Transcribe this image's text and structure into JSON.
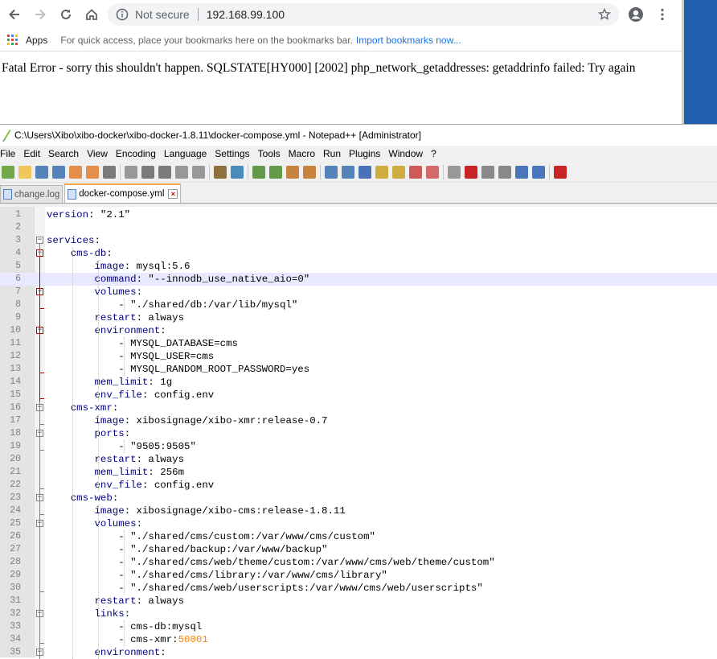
{
  "browser": {
    "security_label": "Not secure",
    "url": "192.168.99.100",
    "bookmarks_apps": "Apps",
    "bookmarks_hint": "For quick access, place your bookmarks here on the bookmarks bar.",
    "bookmarks_import": "Import bookmarks now...",
    "page_error": "Fatal Error - sorry this shouldn't happen. SQLSTATE[HY000] [2002] php_network_getaddresses: getaddrinfo failed: Try again"
  },
  "npp": {
    "title": "C:\\Users\\Xibo\\xibo-docker\\xibo-docker-1.8.11\\docker-compose.yml - Notepad++ [Administrator]",
    "menu": [
      "File",
      "Edit",
      "Search",
      "View",
      "Encoding",
      "Language",
      "Settings",
      "Tools",
      "Macro",
      "Run",
      "Plugins",
      "Window",
      "?"
    ],
    "tabs": [
      {
        "label": "change.log",
        "active": false
      },
      {
        "label": "docker-compose.yml",
        "active": true
      }
    ],
    "lines": [
      {
        "n": "1",
        "text": "version: \"2.1\""
      },
      {
        "n": "2",
        "text": ""
      },
      {
        "n": "3",
        "text": "services:"
      },
      {
        "n": "4",
        "text": "    cms-db:"
      },
      {
        "n": "5",
        "text": "        image: mysql:5.6"
      },
      {
        "n": "6",
        "text": "        command: \"--innodb_use_native_aio=0\""
      },
      {
        "n": "7",
        "text": "        volumes:"
      },
      {
        "n": "8",
        "text": "            - \"./shared/db:/var/lib/mysql\""
      },
      {
        "n": "9",
        "text": "        restart: always"
      },
      {
        "n": "10",
        "text": "        environment:"
      },
      {
        "n": "11",
        "text": "            - MYSQL_DATABASE=cms"
      },
      {
        "n": "12",
        "text": "            - MYSQL_USER=cms"
      },
      {
        "n": "13",
        "text": "            - MYSQL_RANDOM_ROOT_PASSWORD=yes"
      },
      {
        "n": "14",
        "text": "        mem_limit: 1g"
      },
      {
        "n": "15",
        "text": "        env_file: config.env"
      },
      {
        "n": "16",
        "text": "    cms-xmr:"
      },
      {
        "n": "17",
        "text": "        image: xibosignage/xibo-xmr:release-0.7"
      },
      {
        "n": "18",
        "text": "        ports:"
      },
      {
        "n": "19",
        "text": "            - \"9505:9505\""
      },
      {
        "n": "20",
        "text": "        restart: always"
      },
      {
        "n": "21",
        "text": "        mem_limit: 256m"
      },
      {
        "n": "22",
        "text": "        env_file: config.env"
      },
      {
        "n": "23",
        "text": "    cms-web:"
      },
      {
        "n": "24",
        "text": "        image: xibosignage/xibo-cms:release-1.8.11"
      },
      {
        "n": "25",
        "text": "        volumes:"
      },
      {
        "n": "26",
        "text": "            - \"./shared/cms/custom:/var/www/cms/custom\""
      },
      {
        "n": "27",
        "text": "            - \"./shared/backup:/var/www/backup\""
      },
      {
        "n": "28",
        "text": "            - \"./shared/cms/web/theme/custom:/var/www/cms/web/theme/custom\""
      },
      {
        "n": "29",
        "text": "            - \"./shared/cms/library:/var/www/cms/library\""
      },
      {
        "n": "30",
        "text": "            - \"./shared/cms/web/userscripts:/var/www/cms/web/userscripts\""
      },
      {
        "n": "31",
        "text": "        restart: always"
      },
      {
        "n": "32",
        "text": "        links:"
      },
      {
        "n": "33",
        "text": "            - cms-db:mysql"
      },
      {
        "n": "34",
        "text": "            - cms-xmr:50001"
      },
      {
        "n": "35",
        "text": "        environment:"
      }
    ]
  },
  "colors": {
    "accent_blue": "#1a73e8",
    "keyword": "#000080",
    "number": "#ff8000",
    "current_line": "#e8e8ff",
    "tab_accent": "#f9a63d"
  }
}
